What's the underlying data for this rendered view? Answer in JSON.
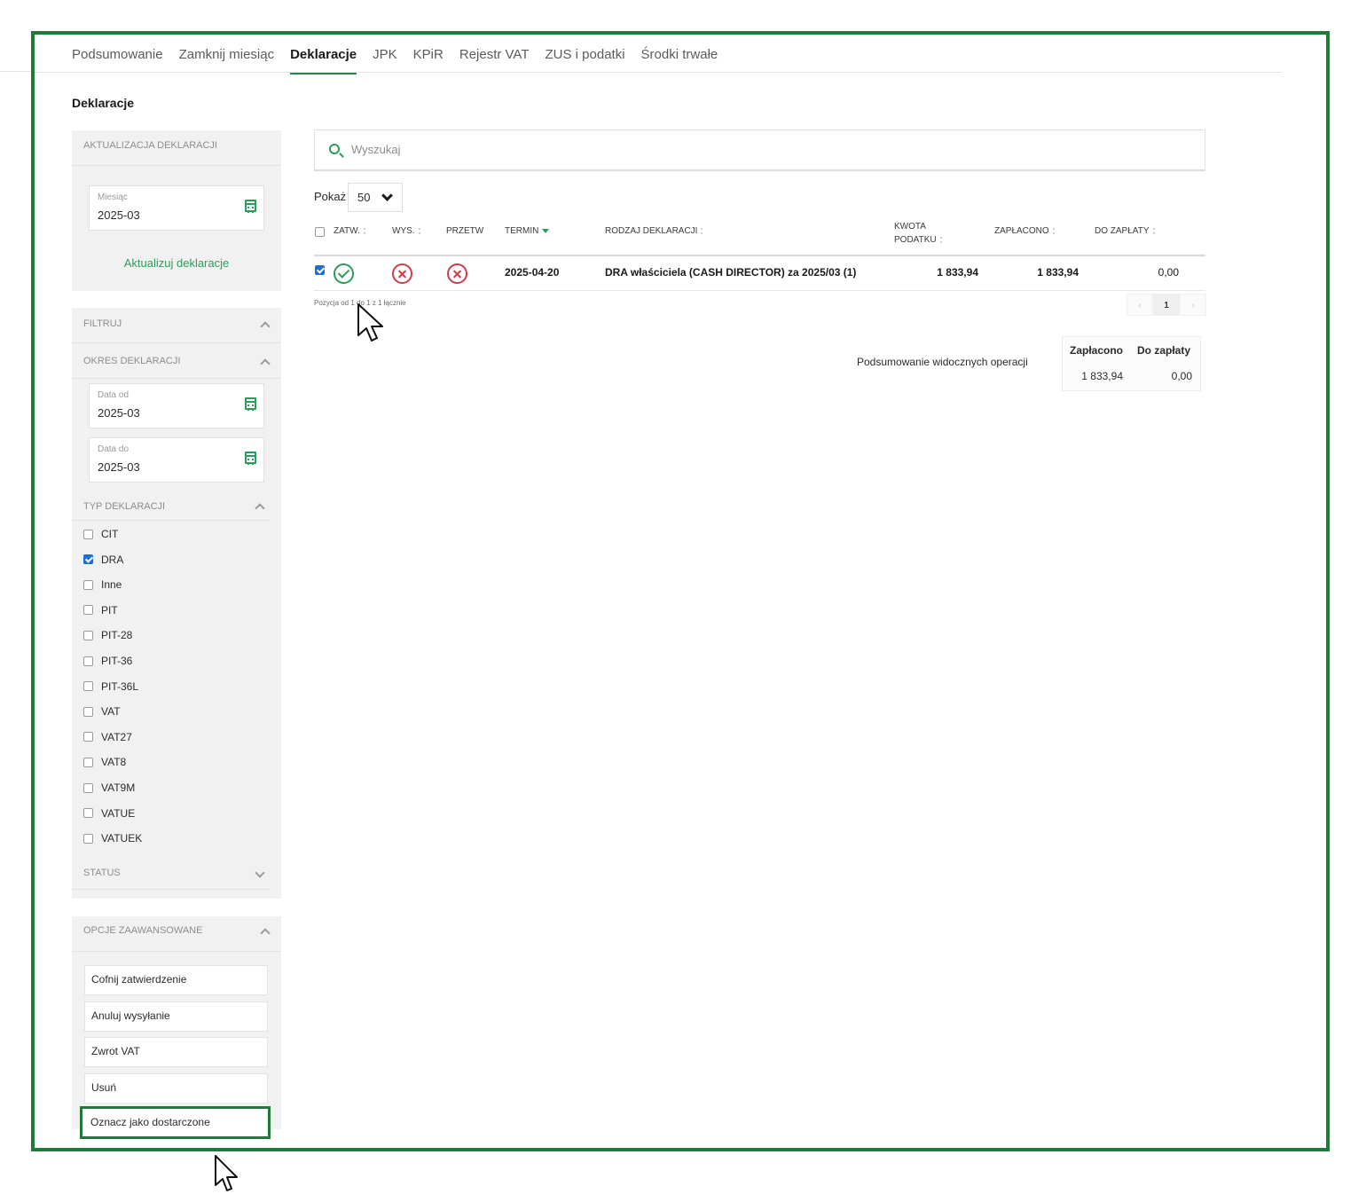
{
  "tabs": [
    {
      "label": "Podsumowanie"
    },
    {
      "label": "Zamknij miesiąc"
    },
    {
      "label": "Deklaracje"
    },
    {
      "label": "JPK"
    },
    {
      "label": "KPiR"
    },
    {
      "label": "Rejestr VAT"
    },
    {
      "label": "ZUS i podatki"
    },
    {
      "label": "Środki trwałe"
    }
  ],
  "active_tab": "Deklaracje",
  "page_title": "Deklaracje",
  "update_panel": {
    "title": "AKTUALIZACJA DEKLARACJI",
    "month_label": "Miesiąc",
    "month_value": "2025-03",
    "action_label": "Aktualizuj deklaracje"
  },
  "filters": {
    "title": "FILTRUJ",
    "period": {
      "title": "OKRES DEKLARACJI",
      "from_label": "Data od",
      "from_value": "2025-03",
      "to_label": "Data do",
      "to_value": "2025-03"
    },
    "types": {
      "title": "TYP DEKLARACJI",
      "items": [
        {
          "label": "CIT",
          "checked": false
        },
        {
          "label": "DRA",
          "checked": true
        },
        {
          "label": "Inne",
          "checked": false
        },
        {
          "label": "PIT",
          "checked": false
        },
        {
          "label": "PIT-28",
          "checked": false
        },
        {
          "label": "PIT-36",
          "checked": false
        },
        {
          "label": "PIT-36L",
          "checked": false
        },
        {
          "label": "VAT",
          "checked": false
        },
        {
          "label": "VAT27",
          "checked": false
        },
        {
          "label": "VAT8",
          "checked": false
        },
        {
          "label": "VAT9M",
          "checked": false
        },
        {
          "label": "VATUE",
          "checked": false
        },
        {
          "label": "VATUEK",
          "checked": false
        }
      ]
    },
    "status_title": "STATUS"
  },
  "advanced": {
    "title": "OPCJE ZAAWANSOWANE",
    "buttons": [
      {
        "label": "Cofnij zatwierdzenie"
      },
      {
        "label": "Anuluj wysyłanie"
      },
      {
        "label": "Zwrot VAT"
      },
      {
        "label": "Usuń"
      },
      {
        "label": "Oznacz jako dostarczone"
      }
    ]
  },
  "search": {
    "placeholder": "Wyszukaj"
  },
  "page_size": {
    "label": "Pokaż",
    "value": "50"
  },
  "table": {
    "headers": {
      "zatw": "ZATW.",
      "wys": "WYS.",
      "przetw": "PRZETW",
      "termin": "TERMIN",
      "rodzaj": "RODZAJ DEKLARACJI",
      "kwota": "KWOTA PODATKU",
      "zaplacono": "ZAPŁACONO",
      "do_zaplaty": "DO ZAPŁATY"
    },
    "rows": [
      {
        "selected": true,
        "zatw": "ok-icon",
        "wys": "x-icon",
        "przetw": "x-icon",
        "termin": "2025-04-20",
        "rodzaj": "DRA właściciela (CASH DIRECTOR) za 2025/03 (1)",
        "kwota": "1 833,94",
        "zaplacono": "1 833,94",
        "do_zaplaty": "0,00"
      }
    ]
  },
  "pagination": {
    "info": "Pozycja od 1 do 1 z 1 łącznie",
    "prev": "‹",
    "current": "1",
    "next": "›"
  },
  "summary": {
    "label": "Podsumowanie widocznych operacji",
    "paid_header": "Zapłacono",
    "due_header": "Do zapłaty",
    "paid_value": "1 833,94",
    "due_value": "0,00"
  },
  "colors": {
    "accent": "#2a9d5c",
    "frame": "#1f7a3a",
    "error": "#d23b4a",
    "checkbox": "#1e6fd0"
  }
}
